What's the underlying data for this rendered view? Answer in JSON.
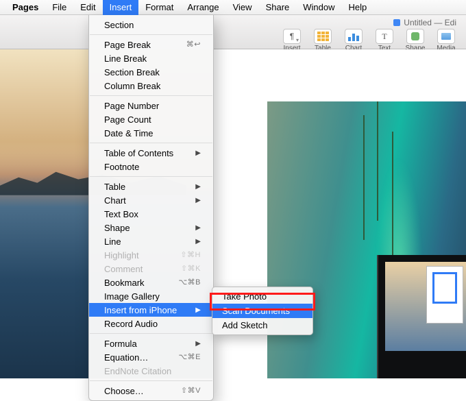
{
  "menubar": {
    "app": "Pages",
    "items": [
      "File",
      "Edit",
      "Insert",
      "Format",
      "Arrange",
      "View",
      "Share",
      "Window",
      "Help"
    ],
    "open_index": 2
  },
  "window": {
    "title": "Untitled — Edi",
    "toolbar": [
      {
        "name": "insert",
        "label": "Insert"
      },
      {
        "name": "table",
        "label": "Table"
      },
      {
        "name": "chart",
        "label": "Chart"
      },
      {
        "name": "text",
        "label": "Text"
      },
      {
        "name": "shape",
        "label": "Shape"
      },
      {
        "name": "media",
        "label": "Media"
      }
    ]
  },
  "insert_menu": [
    {
      "label": "Section"
    },
    {
      "sep": true
    },
    {
      "label": "Page Break",
      "shortcut": "⌘↩"
    },
    {
      "label": "Line Break"
    },
    {
      "label": "Section Break"
    },
    {
      "label": "Column Break"
    },
    {
      "sep": true
    },
    {
      "label": "Page Number"
    },
    {
      "label": "Page Count"
    },
    {
      "label": "Date & Time"
    },
    {
      "sep": true
    },
    {
      "label": "Table of Contents",
      "submenu": true
    },
    {
      "label": "Footnote"
    },
    {
      "sep": true
    },
    {
      "label": "Table",
      "submenu": true
    },
    {
      "label": "Chart",
      "submenu": true
    },
    {
      "label": "Text Box"
    },
    {
      "label": "Shape",
      "submenu": true
    },
    {
      "label": "Line",
      "submenu": true
    },
    {
      "label": "Highlight",
      "shortcut": "⇧⌘H",
      "disabled": true
    },
    {
      "label": "Comment",
      "shortcut": "⇧⌘K",
      "disabled": true
    },
    {
      "label": "Bookmark",
      "shortcut": "⌥⌘B"
    },
    {
      "label": "Image Gallery"
    },
    {
      "label": "Insert from iPhone",
      "submenu": true,
      "selected": true
    },
    {
      "label": "Record Audio"
    },
    {
      "sep": true
    },
    {
      "label": "Formula",
      "submenu": true
    },
    {
      "label": "Equation…",
      "shortcut": "⌥⌘E"
    },
    {
      "label": "EndNote Citation",
      "disabled": true
    },
    {
      "sep": true
    },
    {
      "label": "Choose…",
      "shortcut": "⇧⌘V"
    }
  ],
  "iphone_submenu": {
    "header": "",
    "items": [
      "Take Photo",
      "Scan Documents",
      "Add Sketch"
    ],
    "selected_index": 1
  }
}
